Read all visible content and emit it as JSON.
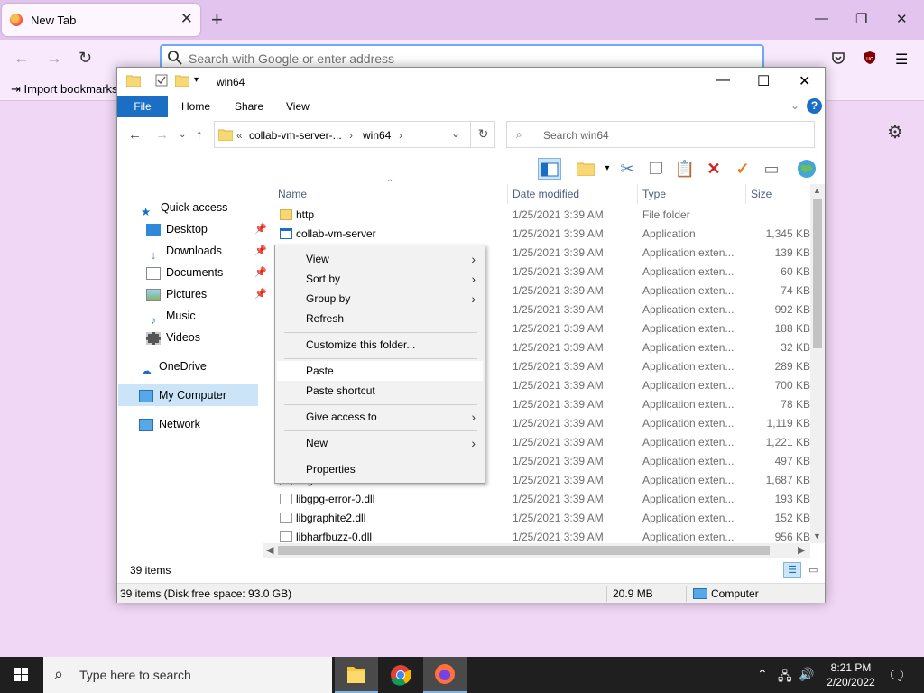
{
  "browser": {
    "tab_title": "New Tab",
    "url_placeholder": "Search with Google or enter address",
    "import_bookmarks": "Import bookmarks"
  },
  "explorer": {
    "title": "win64",
    "ribbon": {
      "file": "File",
      "home": "Home",
      "share": "Share",
      "view": "View",
      "help": "?"
    },
    "address": {
      "prefix": "«",
      "seg1": "collab-vm-server-...",
      "sep": "›",
      "seg2": "win64"
    },
    "search_placeholder": "Search win64",
    "nav": {
      "quick_access": "Quick access",
      "desktop": "Desktop",
      "downloads": "Downloads",
      "documents": "Documents",
      "pictures": "Pictures",
      "music": "Music",
      "videos": "Videos",
      "onedrive": "OneDrive",
      "my_computer": "My Computer",
      "network": "Network"
    },
    "columns": {
      "name": "Name",
      "date": "Date modified",
      "type": "Type",
      "size": "Size"
    },
    "files": [
      {
        "name": "http",
        "date": "1/25/2021 3:39 AM",
        "type": "File folder",
        "size": "",
        "kind": "folder"
      },
      {
        "name": "collab-vm-server",
        "date": "1/25/2021 3:39 AM",
        "type": "Application",
        "size": "1,345 KB",
        "kind": "app"
      },
      {
        "name": "",
        "date": "1/25/2021 3:39 AM",
        "type": "Application exten...",
        "size": "139 KB",
        "kind": "dll"
      },
      {
        "name": "",
        "date": "1/25/2021 3:39 AM",
        "type": "Application exten...",
        "size": "60 KB",
        "kind": "dll"
      },
      {
        "name": "",
        "date": "1/25/2021 3:39 AM",
        "type": "Application exten...",
        "size": "74 KB",
        "kind": "dll"
      },
      {
        "name": "",
        "date": "1/25/2021 3:39 AM",
        "type": "Application exten...",
        "size": "992 KB",
        "kind": "dll"
      },
      {
        "name": "",
        "date": "1/25/2021 3:39 AM",
        "type": "Application exten...",
        "size": "188 KB",
        "kind": "dll"
      },
      {
        "name": "",
        "date": "1/25/2021 3:39 AM",
        "type": "Application exten...",
        "size": "32 KB",
        "kind": "dll"
      },
      {
        "name": "",
        "date": "1/25/2021 3:39 AM",
        "type": "Application exten...",
        "size": "289 KB",
        "kind": "dll"
      },
      {
        "name": "",
        "date": "1/25/2021 3:39 AM",
        "type": "Application exten...",
        "size": "700 KB",
        "kind": "dll"
      },
      {
        "name": "",
        "date": "1/25/2021 3:39 AM",
        "type": "Application exten...",
        "size": "78 KB",
        "kind": "dll"
      },
      {
        "name": "",
        "date": "1/25/2021 3:39 AM",
        "type": "Application exten...",
        "size": "1,119 KB",
        "kind": "dll"
      },
      {
        "name": "",
        "date": "1/25/2021 3:39 AM",
        "type": "Application exten...",
        "size": "1,221 KB",
        "kind": "dll"
      },
      {
        "name": "",
        "date": "1/25/2021 3:39 AM",
        "type": "Application exten...",
        "size": "497 KB",
        "kind": "dll"
      },
      {
        "name": "libgnutls-30.dll",
        "date": "1/25/2021 3:39 AM",
        "type": "Application exten...",
        "size": "1,687 KB",
        "kind": "dll"
      },
      {
        "name": "libgpg-error-0.dll",
        "date": "1/25/2021 3:39 AM",
        "type": "Application exten...",
        "size": "193 KB",
        "kind": "dll"
      },
      {
        "name": "libgraphite2.dll",
        "date": "1/25/2021 3:39 AM",
        "type": "Application exten...",
        "size": "152 KB",
        "kind": "dll"
      },
      {
        "name": "libharfbuzz-0.dll",
        "date": "1/25/2021 3:39 AM",
        "type": "Application exten...",
        "size": "956 KB",
        "kind": "dll"
      }
    ],
    "item_count": "39 items",
    "status": {
      "left": "39 items (Disk free space: 93.0 GB)",
      "size": "20.9 MB",
      "location": "Computer"
    }
  },
  "context_menu": {
    "view": "View",
    "sort_by": "Sort by",
    "group_by": "Group by",
    "refresh": "Refresh",
    "customize": "Customize this folder...",
    "paste": "Paste",
    "paste_shortcut": "Paste shortcut",
    "give_access": "Give access to",
    "new": "New",
    "properties": "Properties"
  },
  "taskbar": {
    "search_placeholder": "Type here to search",
    "time": "8:21 PM",
    "date": "2/20/2022"
  },
  "colors": {
    "accent": "#1a6fc4",
    "selection": "#cce4f7",
    "browser_bg": "#f0d7f5"
  }
}
